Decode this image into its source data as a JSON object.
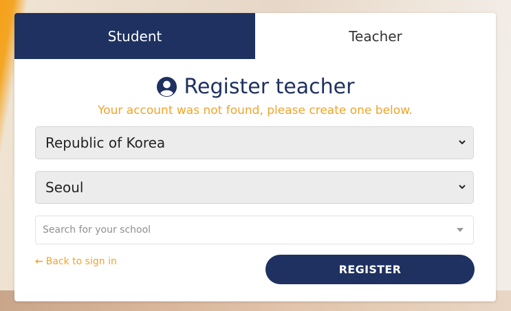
{
  "tabs": [
    {
      "label": "Student",
      "active": true
    },
    {
      "label": "Teacher",
      "active": false
    }
  ],
  "heading": {
    "icon": "user-circle-icon",
    "title": "Register teacher"
  },
  "notice": "Your account was not found, please create one below.",
  "country_select": {
    "value": "Republic of Korea"
  },
  "city_select": {
    "value": "Seoul"
  },
  "school_search": {
    "placeholder": "Search for your school",
    "value": ""
  },
  "back_link": {
    "label": "Back to sign in",
    "icon": "arrow-left-icon"
  },
  "register_button": {
    "label": "REGISTER"
  },
  "colors": {
    "primary": "#1e3160",
    "accent": "#f0a32b"
  }
}
